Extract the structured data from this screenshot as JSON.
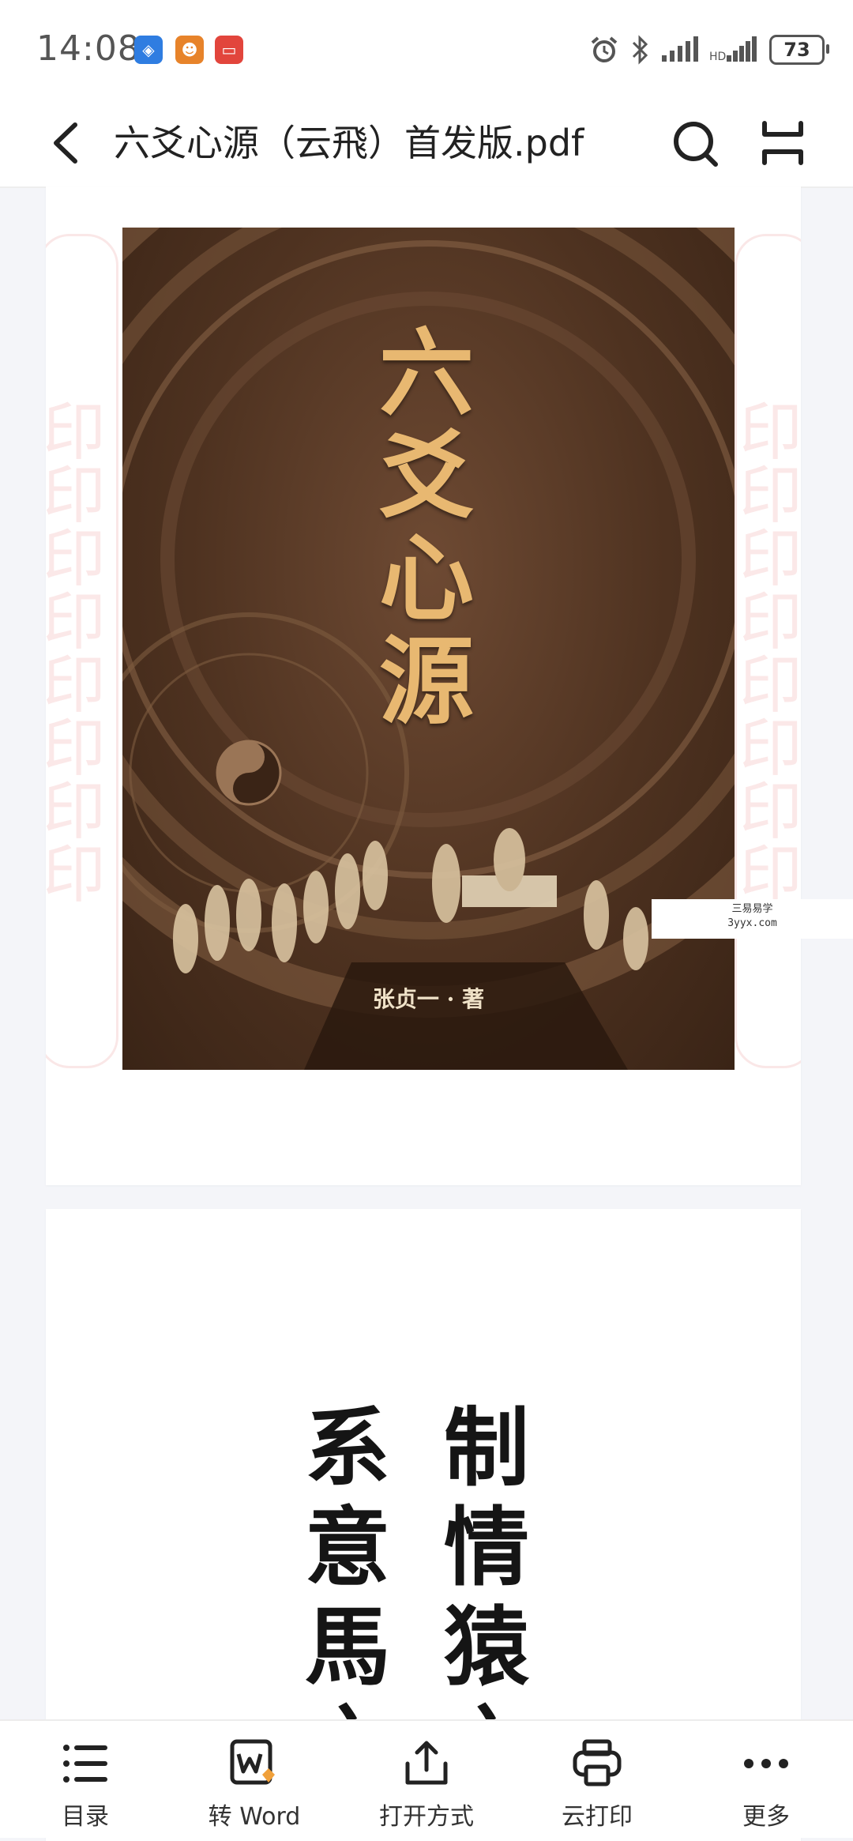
{
  "status_bar": {
    "time": "14:08",
    "battery": "73",
    "apps": [
      "shield-app-icon",
      "robot-app-icon",
      "message-app-icon"
    ],
    "colors": {
      "blue": "#2f7de1",
      "orange": "#e7832a",
      "red": "#e2453c"
    }
  },
  "nav": {
    "title": "六爻心源（云飛）首发版.pdf"
  },
  "cover": {
    "title_chars": [
      "六",
      "爻",
      "心",
      "源"
    ],
    "author": "张贞一 · 著"
  },
  "watermark": {
    "line1": "三易易学",
    "line2": "3yyx.com"
  },
  "page2": {
    "left_column": [
      "系",
      "意",
      "馬",
      "之"
    ],
    "right_column": [
      "制",
      "情",
      "猿",
      "之"
    ]
  },
  "toolbar": {
    "items": [
      {
        "label": "目录",
        "icon": "list-icon"
      },
      {
        "label": "转 Word",
        "icon": "word-convert-icon"
      },
      {
        "label": "打开方式",
        "icon": "share-icon"
      },
      {
        "label": "云打印",
        "icon": "printer-icon"
      },
      {
        "label": "更多",
        "icon": "more-icon"
      }
    ]
  }
}
